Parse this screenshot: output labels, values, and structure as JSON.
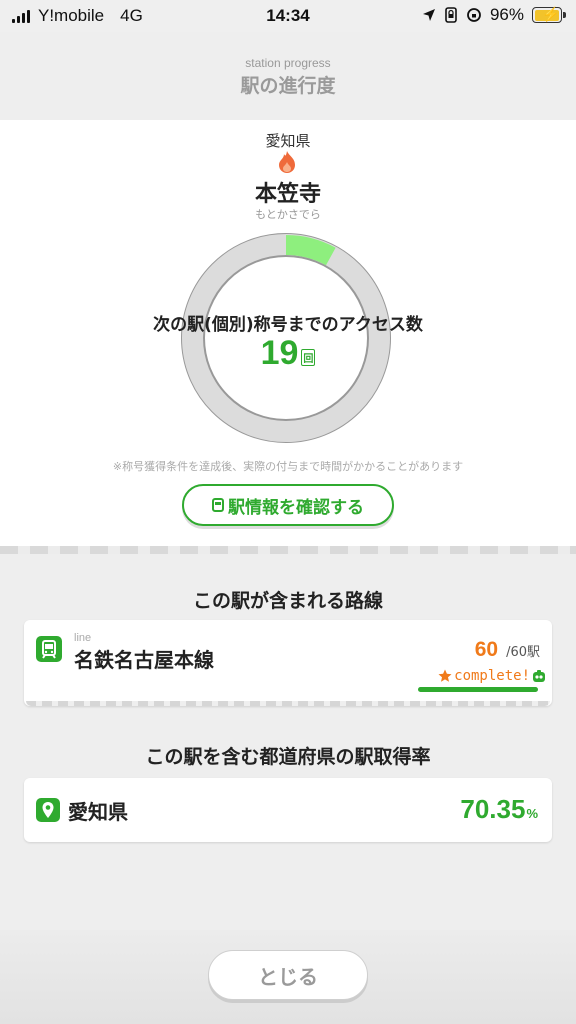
{
  "status_bar": {
    "carrier": "Y!mobile",
    "network": "4G",
    "time": "14:34",
    "battery": "96%"
  },
  "header": {
    "subtitle": "station progress",
    "title": "駅の進行度"
  },
  "station": {
    "prefecture": "愛知県",
    "name": "本笠寺",
    "kana": "もとかさでら",
    "next_label": "次の駅(個別)称号までのアクセス数",
    "count": "19",
    "count_unit": "回",
    "progress_fraction": 0.08,
    "note": "※称号獲得条件を達成後、実際の付与まで時間がかかることがあります",
    "info_button": "駅情報を確認する"
  },
  "lines_section": {
    "title": "この駅が含まれる路線",
    "items": [
      {
        "tag": "line",
        "name": "名鉄名古屋本線",
        "acquired": "60",
        "total": "/60駅",
        "status": "complete!"
      }
    ]
  },
  "prefecture_section": {
    "title": "この駅を含む都道府県の駅取得率",
    "name": "愛知県",
    "rate": "70.35",
    "rate_unit": "%"
  },
  "footer": {
    "close_button": "とじる"
  },
  "colors": {
    "accent_green": "#2faa2f",
    "progress_green": "#8eef7e",
    "complete_orange": "#f07a1a"
  },
  "icons": [
    "signal-icon",
    "location-arrow-icon",
    "lock-rotation-icon",
    "battery-icon",
    "flame-icon",
    "train-icon",
    "pin-icon",
    "star-icon",
    "mascot-icon"
  ]
}
